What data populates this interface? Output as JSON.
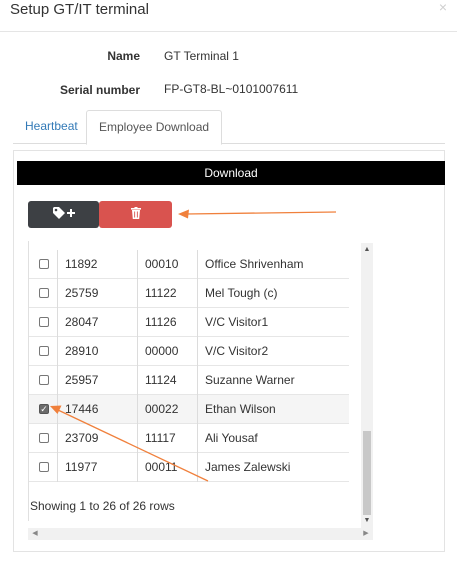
{
  "modal": {
    "title": "Setup GT/IT terminal",
    "close_glyph": "×"
  },
  "info": {
    "name_label": "Name",
    "name_value": "GT Terminal 1",
    "serial_label": "Serial number",
    "serial_value": "FP-GT8-BL~0101007611"
  },
  "tabs": [
    {
      "label": "Heartbeat",
      "active": false
    },
    {
      "label": "Employee Download",
      "active": true
    }
  ],
  "panel": {
    "header": "Download"
  },
  "toolbar": {
    "add_tag_icon": "tag-plus-icon",
    "delete_icon": "trash-icon"
  },
  "table": {
    "rows": [
      {
        "checked": false,
        "id": "11892",
        "code": "00010",
        "name": "Office Shrivenham"
      },
      {
        "checked": false,
        "id": "25759",
        "code": "11122",
        "name": "Mel Tough (c)"
      },
      {
        "checked": false,
        "id": "28047",
        "code": "11126",
        "name": "V/C Visitor1"
      },
      {
        "checked": false,
        "id": "28910",
        "code": "00000",
        "name": "V/C Visitor2"
      },
      {
        "checked": false,
        "id": "25957",
        "code": "11124",
        "name": "Suzanne Warner"
      },
      {
        "checked": true,
        "id": "17446",
        "code": "00022",
        "name": "Ethan Wilson"
      },
      {
        "checked": false,
        "id": "23709",
        "code": "11117",
        "name": "Ali Yousaf"
      },
      {
        "checked": false,
        "id": "11977",
        "code": "00011",
        "name": "James Zalewski"
      }
    ],
    "footer": "Showing 1 to 26 of 26 rows"
  },
  "colors": {
    "accent_link": "#337ab7",
    "delete_button": "#d9534f",
    "dark_button": "#3d4044",
    "annotation_arrow": "#f0803c",
    "panel_header": "#000000"
  }
}
